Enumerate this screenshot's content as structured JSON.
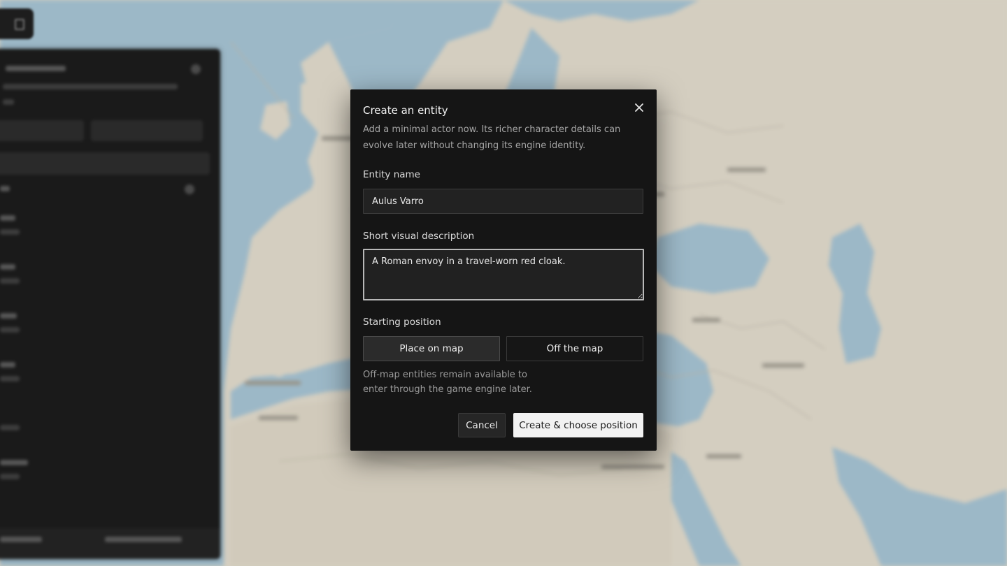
{
  "modal": {
    "title": "Create an entity",
    "description": "Add a minimal actor now. Its richer character details can evolve later without changing its engine identity.",
    "close_icon": "close-icon",
    "fields": {
      "name_label": "Entity name",
      "name_value": "Aulus Varro",
      "description_label": "Short visual description",
      "description_value": "A Roman envoy in a travel-worn red cloak.",
      "position_label": "Starting position"
    },
    "position_options": {
      "on_map": "Place on map",
      "off_map": "Off the map",
      "selected": "Place on map"
    },
    "helper_text": "Off-map entities remain available to enter through the game engine later.",
    "actions": {
      "cancel": "Cancel",
      "confirm": "Create & choose position"
    }
  },
  "colors": {
    "modal_bg": "#151515",
    "map_land": "#e6e0d1",
    "map_water": "#aac8d8",
    "primary_button_bg": "#f2f2f2"
  }
}
